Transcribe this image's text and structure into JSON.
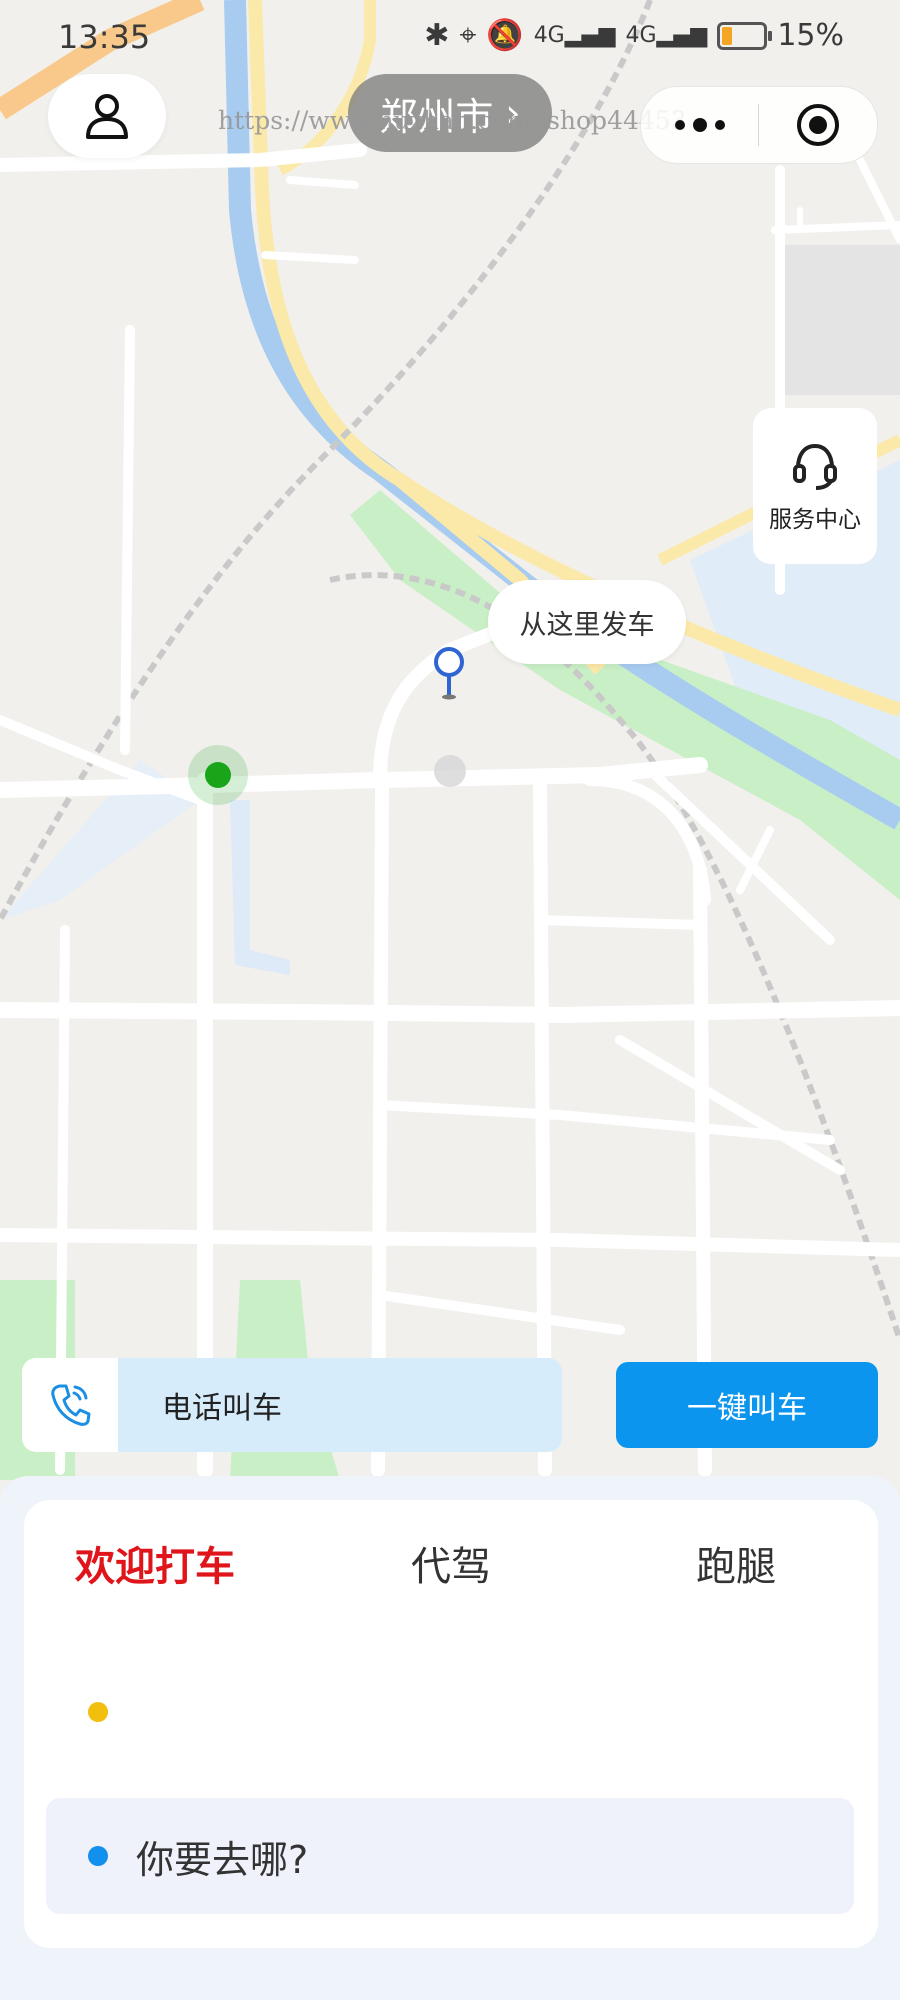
{
  "status_bar": {
    "time": "13:35",
    "battery": "15%",
    "battery_level": 0.15
  },
  "top_bar": {
    "city": "郑州市",
    "watermark": "https://www.huzhan.com/ishop44453"
  },
  "map": {
    "service_center_label": "服务中心",
    "depart_bubble": "从这里发车"
  },
  "actions": {
    "phone_call_label": "电话叫车",
    "one_click_label": "一键叫车"
  },
  "panel": {
    "tabs": [
      {
        "label": "欢迎打车",
        "active": true
      },
      {
        "label": "代驾",
        "active": false
      },
      {
        "label": "跑腿",
        "active": false
      }
    ],
    "destination_placeholder": "你要去哪?"
  },
  "colors": {
    "accent_blue": "#0b95ef",
    "active_tab_red": "#e0151b",
    "start_dot_yellow": "#f3bf0e",
    "dest_dot_blue": "#1290ec",
    "current_location_green": "#18a51a"
  }
}
